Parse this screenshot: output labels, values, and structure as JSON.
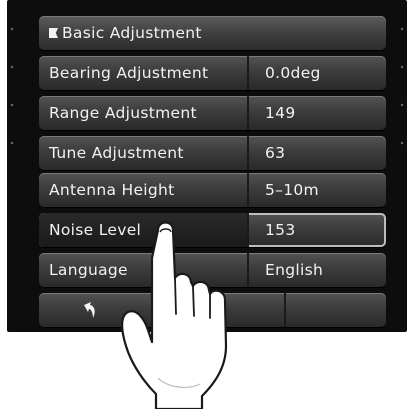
{
  "menu": {
    "header": "Basic Adjustment",
    "items": [
      {
        "label": "Bearing Adjustment",
        "value": "0.0deg"
      },
      {
        "label": "Range Adjustment",
        "value": "149"
      },
      {
        "label": "Tune Adjustment",
        "value": "63"
      },
      {
        "label": "Antenna Height",
        "value": "5–10m"
      },
      {
        "label": "Noise Level",
        "value": "153",
        "selected": true
      },
      {
        "label": "Language",
        "value": "English"
      }
    ]
  },
  "footer": {
    "back_icon": "return-arrow-icon"
  },
  "overlay": {
    "icon": "pointing-hand-icon"
  }
}
